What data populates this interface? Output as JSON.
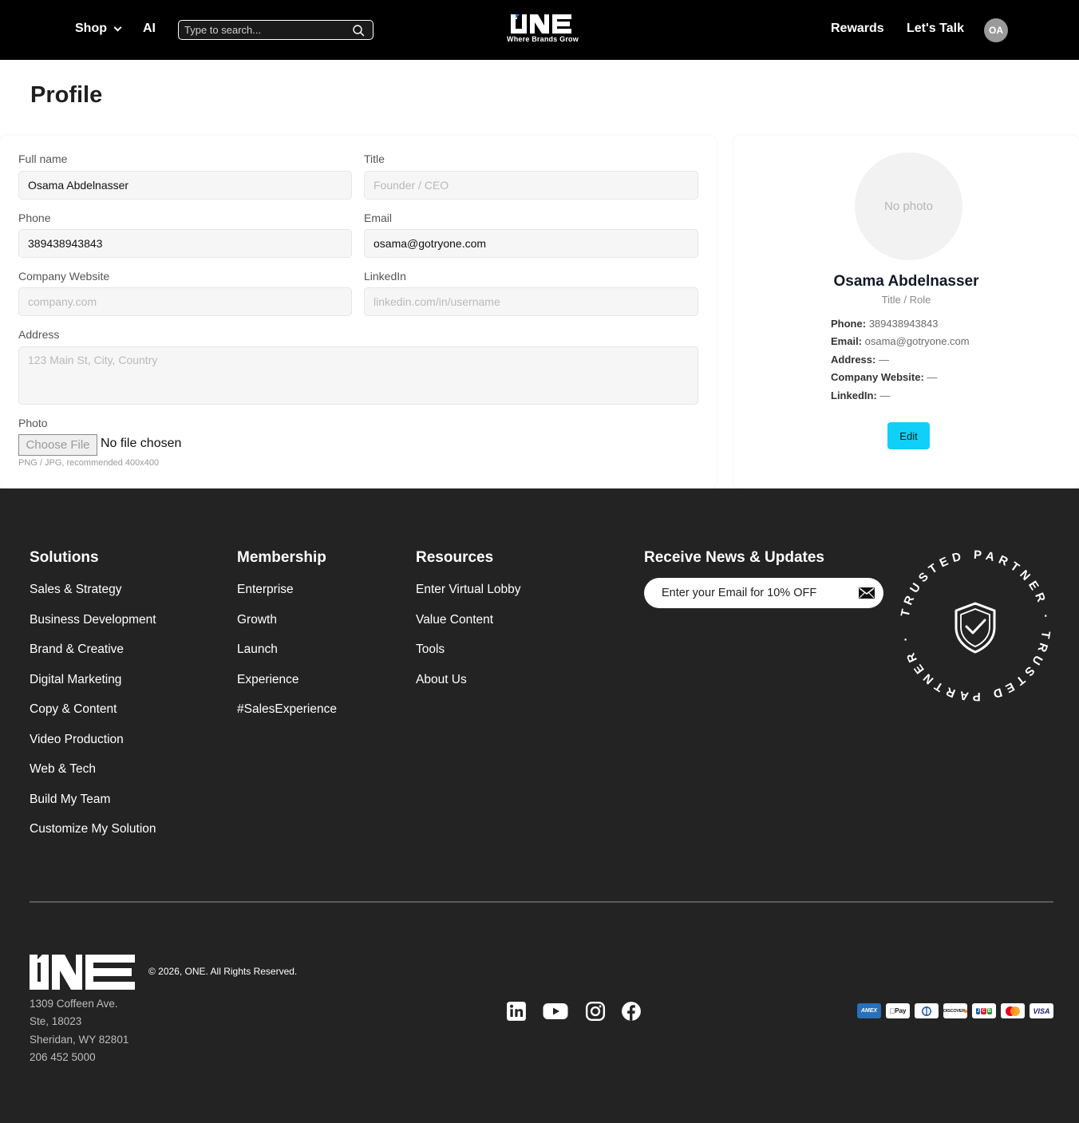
{
  "header": {
    "shop_label": "Shop",
    "ai_label": "AI",
    "search_placeholder": "Type to search...",
    "logo_text": "ONE",
    "logo_tagline": "Where Brands Grow",
    "rewards_label": "Rewards",
    "talk_label": "Let's Talk",
    "avatar_initials": "OA"
  },
  "page": {
    "title": "Profile"
  },
  "form": {
    "full_name": {
      "label": "Full name",
      "value": "Osama Abdelnasser",
      "placeholder": ""
    },
    "title": {
      "label": "Title",
      "value": "",
      "placeholder": "Founder / CEO"
    },
    "phone": {
      "label": "Phone",
      "value": "389438943843",
      "placeholder": ""
    },
    "email": {
      "label": "Email",
      "value": "osama@gotryone.com",
      "placeholder": ""
    },
    "website": {
      "label": "Company Website",
      "value": "",
      "placeholder": "company.com"
    },
    "linkedin": {
      "label": "LinkedIn",
      "value": "",
      "placeholder": "linkedin.com/in/username"
    },
    "address": {
      "label": "Address",
      "value": "",
      "placeholder": "123 Main St, City, Country"
    },
    "photo": {
      "label": "Photo",
      "button": "Choose File",
      "status": "No file chosen",
      "hint": "PNG / JPG, recommended 400x400"
    }
  },
  "profile_card": {
    "photo_placeholder": "No photo",
    "name": "Osama Abdelnasser",
    "role": "Title / Role",
    "phone_label": "Phone:",
    "phone": "389438943843",
    "email_label": "Email:",
    "email": "osama@gotryone.com",
    "address_label": "Address:",
    "address": "—",
    "website_label": "Company Website:",
    "website": "—",
    "linkedin_label": "LinkedIn:",
    "linkedin": "—",
    "edit_label": "Edit"
  },
  "footer": {
    "solutions": {
      "title": "Solutions",
      "links": [
        "Sales & Strategy",
        "Business Development",
        "Brand & Creative",
        "Digital Marketing",
        "Copy & Content",
        "Video Production",
        "Web & Tech",
        "Build My Team",
        "Customize My Solution"
      ]
    },
    "membership": {
      "title": "Membership",
      "links": [
        "Enterprise",
        "Growth",
        "Launch",
        "Experience",
        "#SalesExperience"
      ]
    },
    "resources": {
      "title": "Resources",
      "links": [
        "Enter Virtual Lobby",
        "Value Content",
        "Tools",
        "About Us"
      ]
    },
    "newsletter": {
      "title": "Receive News & Updates",
      "placeholder": "Enter your Email for 10% OFF"
    },
    "badge_text": "TRUSTED PARTNER · TRUSTED PARTNER ·",
    "copyright": "© 2026, ONE. All Rights Reserved.",
    "address": [
      "1309 Coffeen Ave.",
      "Ste, 18023",
      "Sheridan, WY 82801",
      "206 452 5000"
    ],
    "social_icons": [
      "linkedin-icon",
      "youtube-icon",
      "instagram-icon",
      "facebook-icon"
    ],
    "payment_icons": [
      "amex-icon",
      "apple-pay-icon",
      "diners-icon",
      "discover-icon",
      "jcb-icon",
      "mastercard-icon",
      "visa-icon"
    ],
    "payment_labels": {
      "amex": "AMEX",
      "applepay": "Pay",
      "discover": "DISCOVER",
      "jcb": "JCB",
      "visa": "VISA"
    }
  },
  "colors": {
    "header_bg": "#000000",
    "footer_bg": "#232323",
    "accent": "#10d0f7"
  }
}
